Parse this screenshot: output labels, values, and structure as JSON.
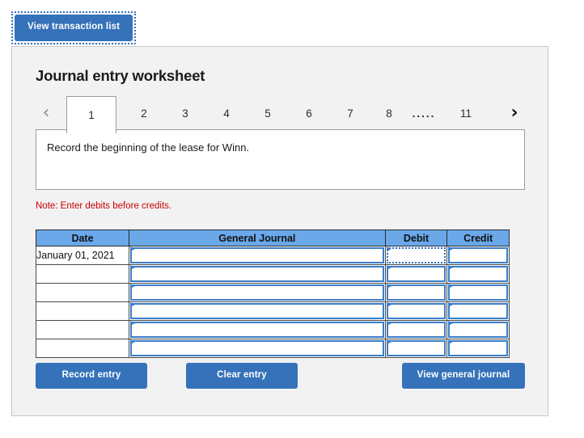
{
  "toolbar": {
    "view_transaction_list_label": "View transaction list"
  },
  "worksheet": {
    "title": "Journal entry worksheet",
    "description": "Record the beginning of the lease for Winn.",
    "note": "Note: Enter debits before credits."
  },
  "tabs": {
    "prev_icon": "‹",
    "next_icon": "›",
    "items": [
      {
        "label": "1",
        "active": true
      },
      {
        "label": "2",
        "active": false
      },
      {
        "label": "3",
        "active": false
      },
      {
        "label": "4",
        "active": false
      },
      {
        "label": "5",
        "active": false
      },
      {
        "label": "6",
        "active": false
      },
      {
        "label": "7",
        "active": false
      },
      {
        "label": "8",
        "active": false
      },
      {
        "label": ".....",
        "active": false,
        "ellipsis": true
      },
      {
        "label": "11",
        "active": false
      }
    ],
    "selected": "1"
  },
  "table": {
    "columns": [
      "Date",
      "General Journal",
      "Debit",
      "Credit"
    ],
    "rows": [
      {
        "date": "January 01, 2021",
        "journal": "",
        "debit": "",
        "credit": ""
      },
      {
        "date": "",
        "journal": "",
        "debit": "",
        "credit": ""
      },
      {
        "date": "",
        "journal": "",
        "debit": "",
        "credit": ""
      },
      {
        "date": "",
        "journal": "",
        "debit": "",
        "credit": ""
      },
      {
        "date": "",
        "journal": "",
        "debit": "",
        "credit": ""
      },
      {
        "date": "",
        "journal": "",
        "debit": "",
        "credit": ""
      }
    ],
    "focused_cell": {
      "row": 0,
      "column": "debit"
    }
  },
  "actions": {
    "record_entry_label": "Record entry",
    "clear_entry_label": "Clear entry",
    "view_general_journal_label": "View general journal"
  },
  "colors": {
    "button_blue": "#3572b9",
    "header_blue": "#6aa8ea",
    "cell_border_blue": "#3b7ec9",
    "note_red": "#cc0000",
    "panel_gray": "#f2f2f2",
    "panel_border": "#c8c8c8"
  }
}
